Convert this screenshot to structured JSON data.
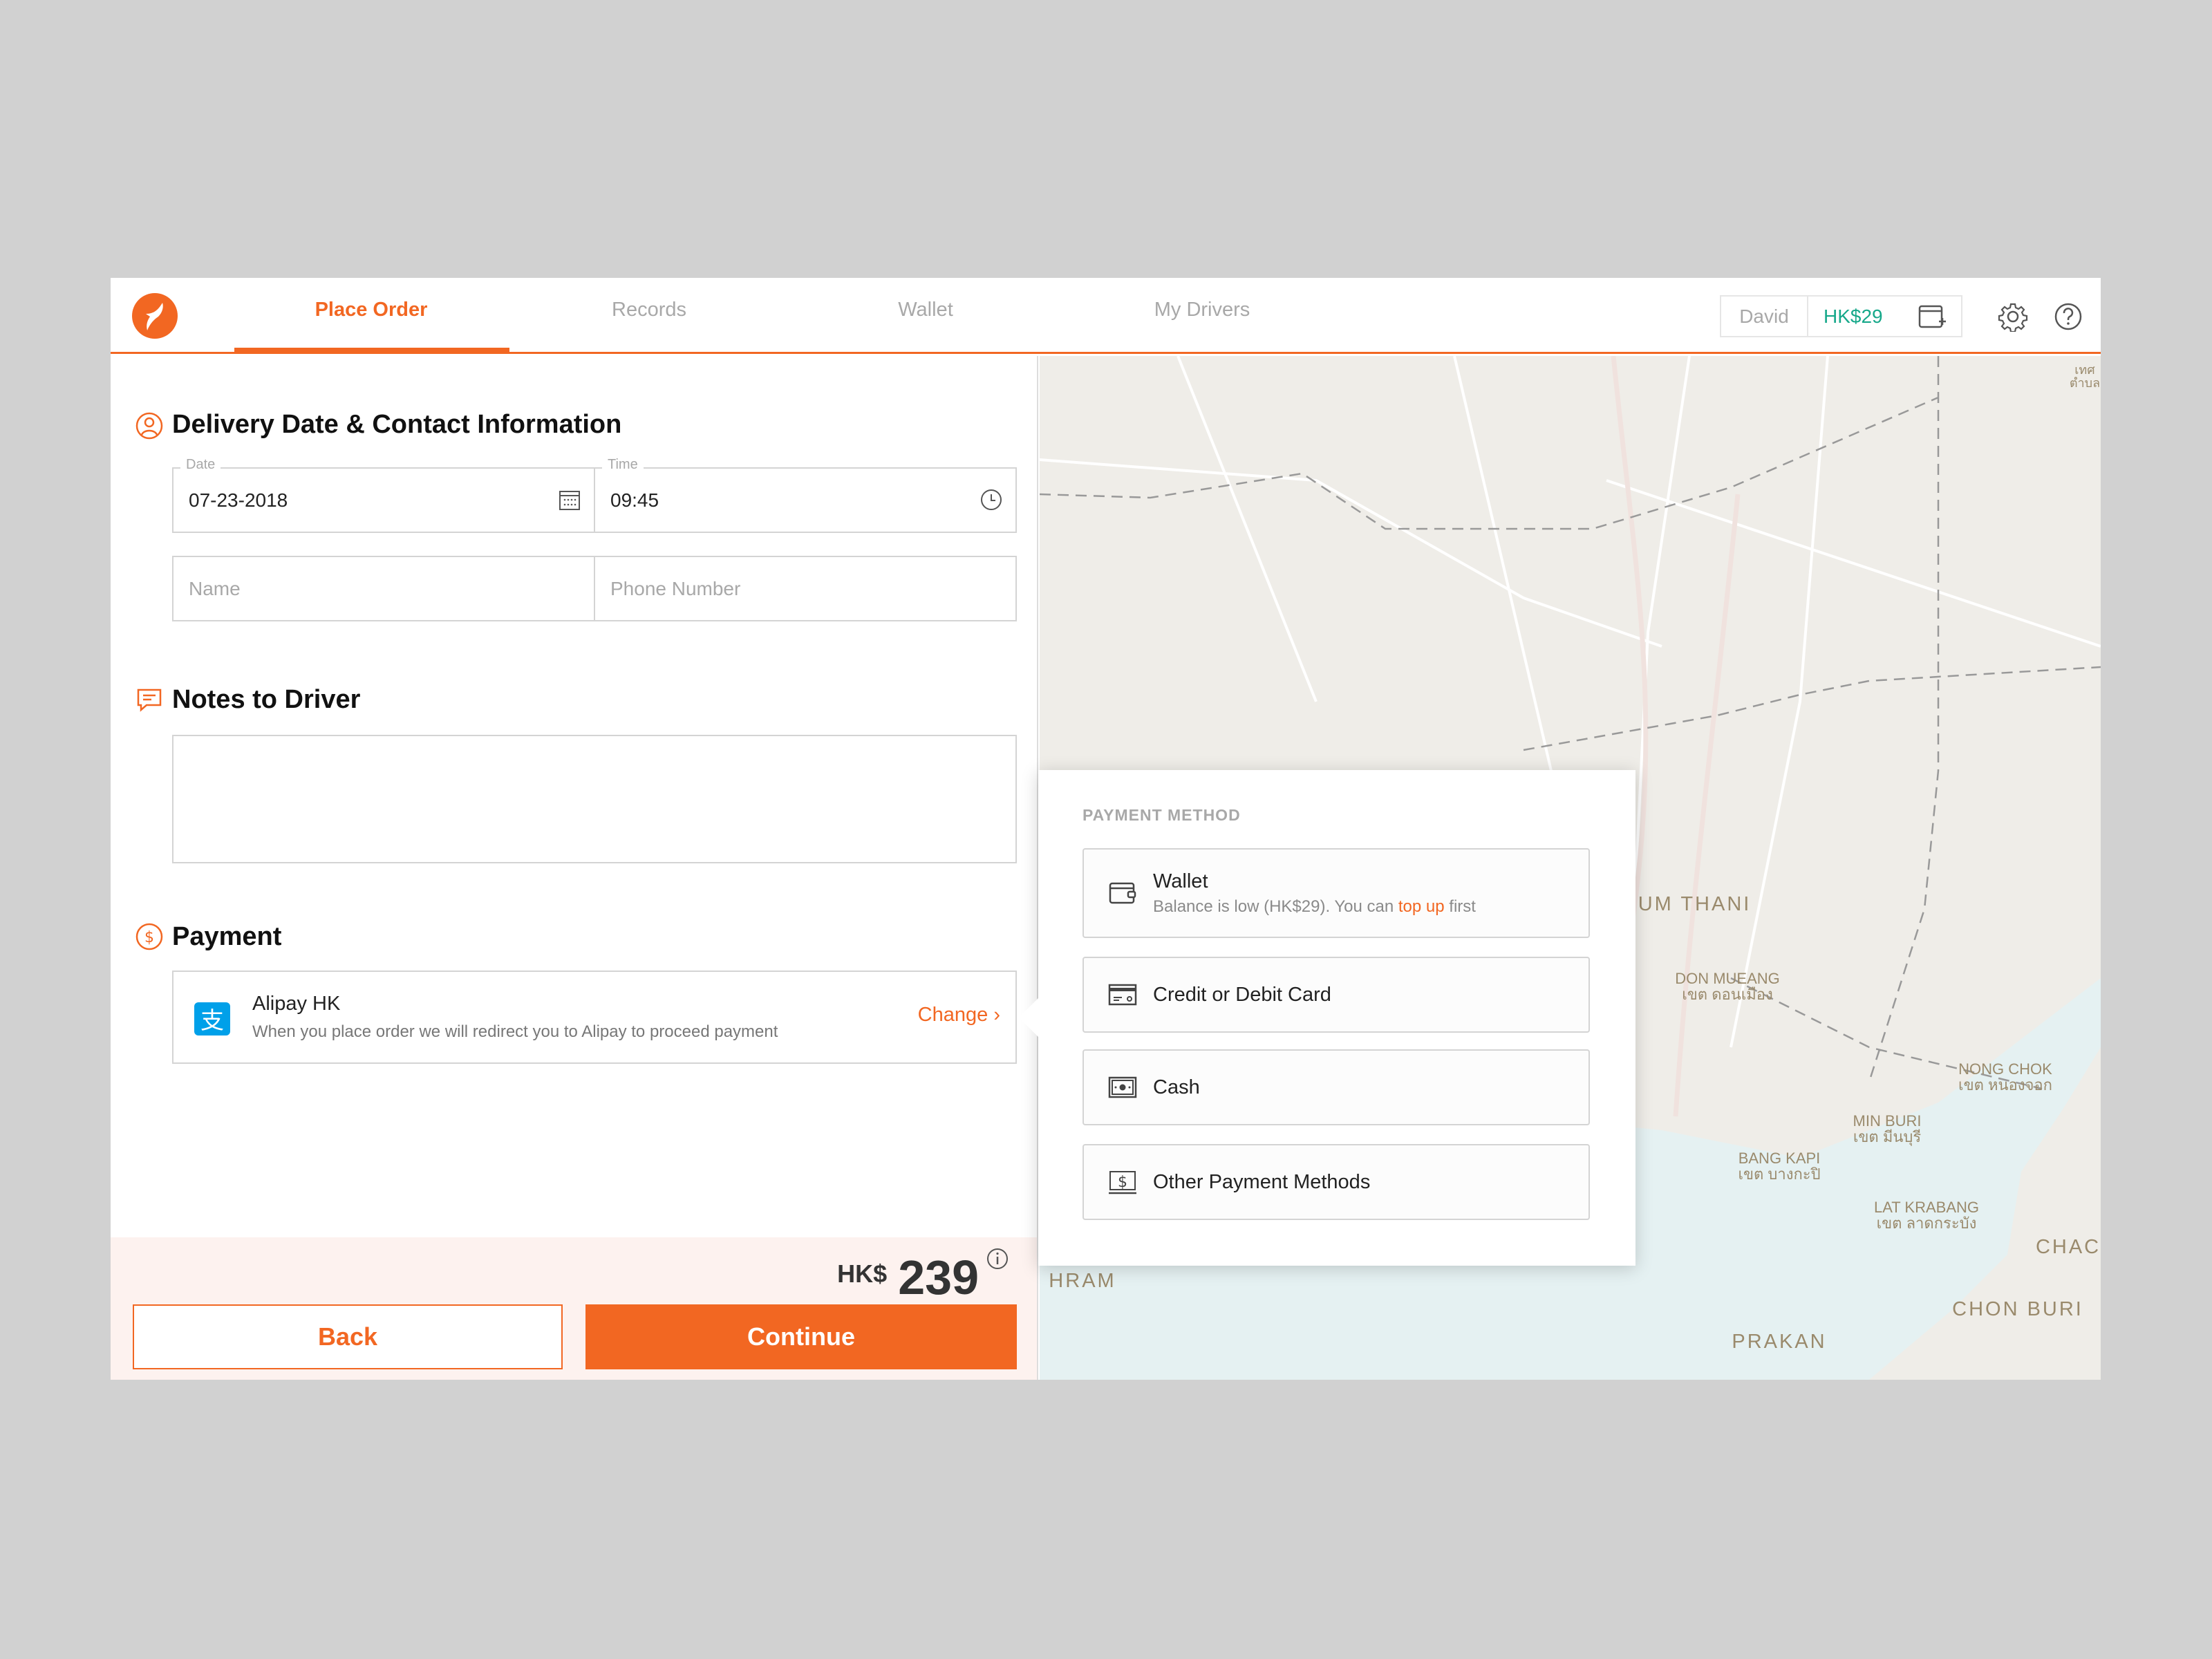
{
  "header": {
    "tabs": [
      {
        "label": "Place Order",
        "active": true
      },
      {
        "label": "Records"
      },
      {
        "label": "Wallet"
      },
      {
        "label": "My Drivers"
      }
    ],
    "user_name": "David",
    "balance": "HK$29"
  },
  "delivery": {
    "title": "Delivery Date & Contact Information",
    "date_label": "Date",
    "date_value": "07-23-2018",
    "time_label": "Time",
    "time_value": "09:45",
    "name_placeholder": "Name",
    "phone_placeholder": "Phone Number"
  },
  "notes": {
    "title": "Notes to Driver",
    "value": ""
  },
  "payment": {
    "title": "Payment",
    "method_name": "Alipay HK",
    "method_desc": "When you place order we will redirect you to Alipay to proceed payment",
    "change_label": "Change"
  },
  "footer": {
    "currency": "HK$",
    "amount": "239",
    "back_label": "Back",
    "continue_label": "Continue"
  },
  "payment_popup": {
    "title": "PAYMENT METHOD",
    "options": [
      {
        "label": "Wallet",
        "sub_before": "Balance is low (HK$29). You can ",
        "sub_link": "top up",
        "sub_after": " first"
      },
      {
        "label": "Credit or Debit Card"
      },
      {
        "label": "Cash"
      },
      {
        "label": "Other Payment Methods"
      }
    ]
  },
  "map": {
    "labels": {
      "pathum_thani": "PATHUM THANI",
      "don_mueang": "DON MUEANG",
      "don_mueang_th": "เขต ดอนเมือง",
      "nong_chok": "NONG CHOK",
      "nong_chok_th": "เขต หนองจอก",
      "min_buri": "MIN BURI",
      "min_buri_th": "เขต มีนบุรี",
      "bang_kapi": "BANG KAPI",
      "bang_kapi_th": "เขต บางกะปิ",
      "lat_krabang": "LAT KRABANG",
      "lat_krabang_th": "เขต ลาดกระบัง",
      "chach": "CHACH",
      "prakan": "PRAKAN",
      "hram": "HRAM",
      "chon_buri": "CHON BURI",
      "top_right_1": "เทศ",
      "top_right_2": "ตำบล"
    }
  },
  "colors": {
    "accent": "#f26722",
    "balance": "#16a88a",
    "alipay": "#00a0e9",
    "footer_bg": "#fdf2ef"
  }
}
